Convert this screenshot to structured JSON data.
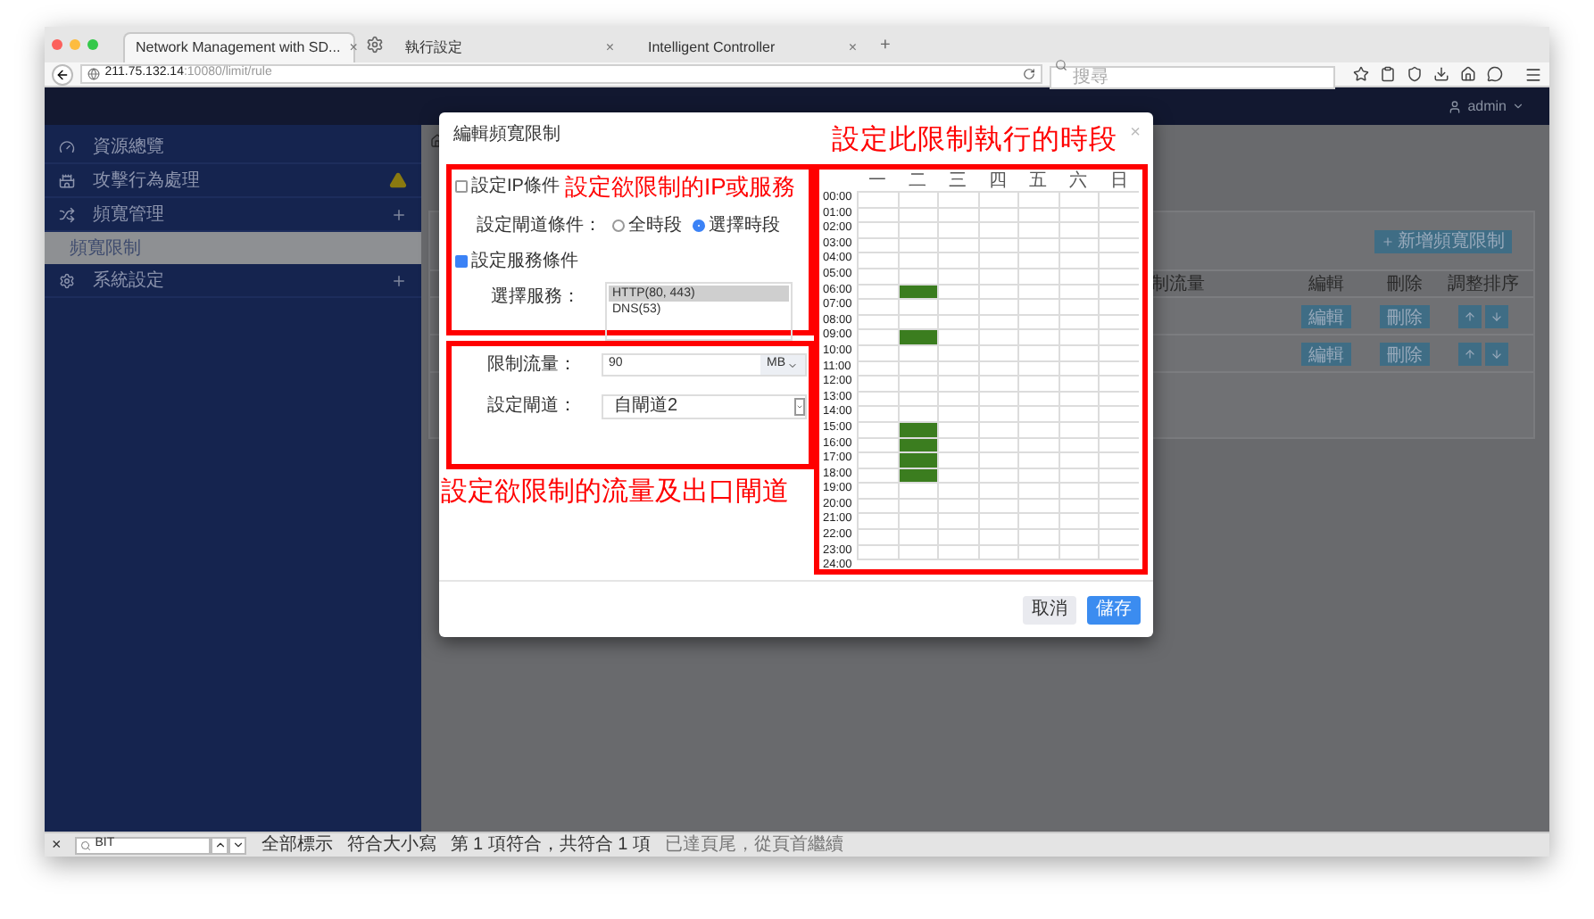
{
  "browser": {
    "tabs": [
      {
        "title": "Network Management with SD...",
        "close": "×",
        "selected": true
      },
      {
        "title": "執行設定",
        "close": "×",
        "selected": false
      },
      {
        "title": "Intelligent Controller",
        "close": "×",
        "selected": false
      }
    ],
    "new_tab": "+",
    "url_host": "211.75.132.14",
    "url_path": ":10080/limit/rule",
    "search_placeholder": "搜尋"
  },
  "header": {
    "user": "admin"
  },
  "sidebar": {
    "items": [
      {
        "label": "資源總覽",
        "kind": "plain"
      },
      {
        "label": "攻擊行為處理",
        "kind": "alert"
      },
      {
        "label": "頻寬管理",
        "kind": "expandable",
        "children": [
          {
            "label": "頻寬限制",
            "selected": true
          }
        ]
      },
      {
        "label": "系統設定",
        "kind": "expandable"
      }
    ]
  },
  "main": {
    "add_button": "新增頻寬限制",
    "table": {
      "columns": [
        "制流量",
        "編輯",
        "刪除",
        "調整排序"
      ],
      "rows": [
        {
          "edit": "編輯",
          "delete": "刪除"
        },
        {
          "edit": "編輯",
          "delete": "刪除"
        }
      ]
    }
  },
  "modal": {
    "title": "編輯頻寬限制",
    "close": "×",
    "ip_condition": {
      "label": "設定IP條件",
      "checked": false
    },
    "gateway_condition": {
      "label": "設定閘道條件：",
      "options": [
        {
          "label": "全時段",
          "selected": false
        },
        {
          "label": "選擇時段",
          "selected": true
        }
      ]
    },
    "service_condition": {
      "label": "設定服務條件",
      "checked": true
    },
    "service_select": {
      "label": "選擇服務：",
      "options": [
        {
          "label": "HTTP(80, 443)",
          "selected": true
        },
        {
          "label": "DNS(53)",
          "selected": false
        }
      ]
    },
    "limit": {
      "label": "限制流量：",
      "value": "90",
      "unit": "MB"
    },
    "gateway": {
      "label": "設定閘道：",
      "value": "自閘道2"
    },
    "schedule": {
      "days": [
        "一",
        "二",
        "三",
        "四",
        "五",
        "六",
        "日"
      ],
      "hours": [
        "00:00",
        "01:00",
        "02:00",
        "03:00",
        "04:00",
        "05:00",
        "06:00",
        "07:00",
        "08:00",
        "09:00",
        "10:00",
        "11:00",
        "12:00",
        "13:00",
        "14:00",
        "15:00",
        "16:00",
        "17:00",
        "18:00",
        "19:00",
        "20:00",
        "21:00",
        "22:00",
        "23:00",
        "24:00"
      ],
      "rows": [
        {
          "slots": [
            false,
            false,
            false,
            false,
            false,
            false,
            false
          ]
        },
        {
          "slots": [
            false,
            false,
            false,
            false,
            false,
            false,
            false
          ]
        },
        {
          "slots": [
            false,
            false,
            false,
            false,
            false,
            false,
            false
          ]
        },
        {
          "slots": [
            false,
            false,
            false,
            false,
            false,
            false,
            false
          ]
        },
        {
          "slots": [
            false,
            false,
            false,
            false,
            false,
            false,
            false
          ]
        },
        {
          "slots": [
            false,
            false,
            false,
            false,
            false,
            false,
            false
          ]
        },
        {
          "slots": [
            false,
            true,
            false,
            false,
            false,
            false,
            false
          ]
        },
        {
          "slots": [
            false,
            false,
            false,
            false,
            false,
            false,
            false
          ]
        },
        {
          "slots": [
            false,
            false,
            false,
            false,
            false,
            false,
            false
          ]
        },
        {
          "slots": [
            false,
            true,
            false,
            false,
            false,
            false,
            false
          ]
        },
        {
          "slots": [
            false,
            false,
            false,
            false,
            false,
            false,
            false
          ]
        },
        {
          "slots": [
            false,
            false,
            false,
            false,
            false,
            false,
            false
          ]
        },
        {
          "slots": [
            false,
            false,
            false,
            false,
            false,
            false,
            false
          ]
        },
        {
          "slots": [
            false,
            false,
            false,
            false,
            false,
            false,
            false
          ]
        },
        {
          "slots": [
            false,
            false,
            false,
            false,
            false,
            false,
            false
          ]
        },
        {
          "slots": [
            false,
            true,
            false,
            false,
            false,
            false,
            false
          ]
        },
        {
          "slots": [
            false,
            true,
            false,
            false,
            false,
            false,
            false
          ]
        },
        {
          "slots": [
            false,
            true,
            false,
            false,
            false,
            false,
            false
          ]
        },
        {
          "slots": [
            false,
            true,
            false,
            false,
            false,
            false,
            false
          ]
        },
        {
          "slots": [
            false,
            false,
            false,
            false,
            false,
            false,
            false
          ]
        },
        {
          "slots": [
            false,
            false,
            false,
            false,
            false,
            false,
            false
          ]
        },
        {
          "slots": [
            false,
            false,
            false,
            false,
            false,
            false,
            false
          ]
        },
        {
          "slots": [
            false,
            false,
            false,
            false,
            false,
            false,
            false
          ]
        },
        {
          "slots": [
            false,
            false,
            false,
            false,
            false,
            false,
            false
          ]
        }
      ]
    },
    "buttons": [
      {
        "label": "取消",
        "kind": "secondary"
      },
      {
        "label": "儲存",
        "kind": "primary"
      }
    ]
  },
  "annotations": [
    {
      "text": "設定欲限制的IP或服務"
    },
    {
      "text": "設定欲限制的流量及出口閘道"
    },
    {
      "text": "設定此限制執行的時段"
    }
  ],
  "find_bar": {
    "close": "×",
    "query": "BIT",
    "highlight_all": "全部標示",
    "match_case": "符合大小寫",
    "result": "第 1 項符合，共符合 1 項",
    "status": "已達頁尾，從頁首繼續"
  }
}
